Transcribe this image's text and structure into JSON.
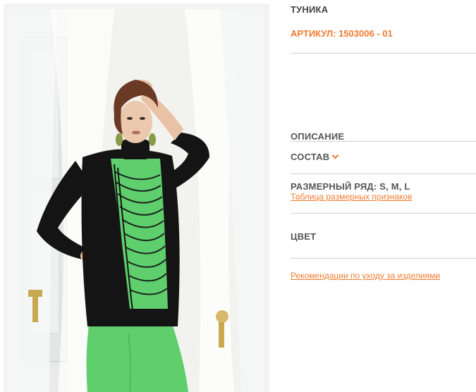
{
  "product": {
    "title": "ТУНИКА",
    "article": "АРТИКУЛ: 1503006 - 01",
    "image": "model-photo"
  },
  "sections": {
    "description_label": "ОПИСАНИЕ",
    "composition_label": "СОСТАВ",
    "size_range_label": "РАЗМЕРНЫЙ РЯД: S, M, L",
    "size_table_link": "Таблица размерных признаков",
    "color_label": "ЦВЕТ",
    "care_link": "Рекомендации по уходу за изделиями"
  },
  "colors": {
    "accent": "#f07b2e",
    "text": "#555555",
    "divider": "#cfcfcf",
    "garment_black": "#141414",
    "garment_green": "#5fcf6e"
  },
  "icons": {
    "expand": "chevron-down-icon"
  }
}
